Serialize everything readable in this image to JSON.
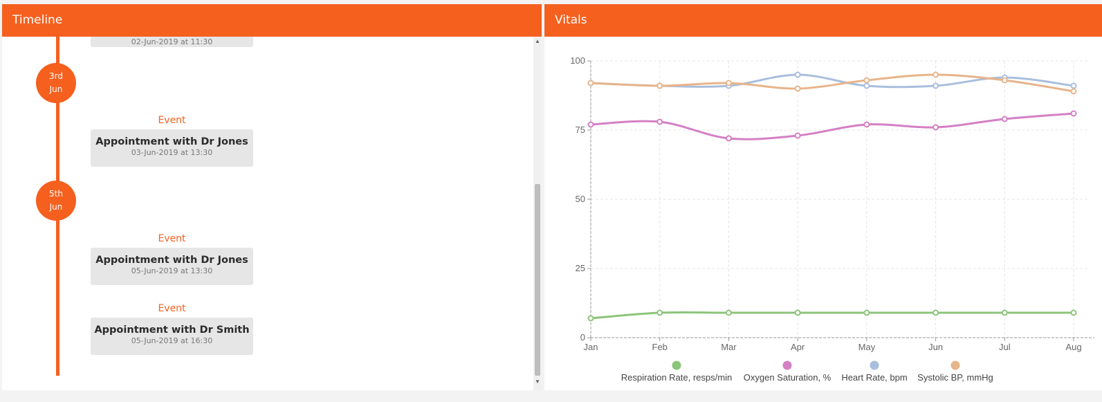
{
  "timeline": {
    "title": "Timeline",
    "partial_card_time": "02-Jun-2019 at 11:30",
    "dates": [
      {
        "day": "3rd",
        "month": "Jun"
      },
      {
        "day": "5th",
        "month": "Jun"
      }
    ],
    "events": [
      {
        "label": "Event",
        "title": "Appointment with Dr Jones",
        "time": "03-Jun-2019 at 13:30"
      },
      {
        "label": "Event",
        "title": "Appointment with Dr Jones",
        "time": "05-Jun-2019 at 13:30"
      },
      {
        "label": "Event",
        "title": "Appointment with Dr Smith",
        "time": "05-Jun-2019 at 16:30"
      }
    ]
  },
  "vitals": {
    "title": "Vitals"
  },
  "chart_data": {
    "type": "line",
    "title": "",
    "xlabel": "",
    "ylabel": "",
    "categories": [
      "Jan",
      "Feb",
      "Mar",
      "Apr",
      "May",
      "Jun",
      "Jul",
      "Aug"
    ],
    "ylim": [
      0,
      100
    ],
    "yticks": [
      0,
      25,
      50,
      75,
      100
    ],
    "grid": true,
    "legend": "bottom",
    "series": [
      {
        "name": "Respiration Rate, resps/min",
        "color": "#8cc47a",
        "values": [
          7,
          9,
          9,
          9,
          9,
          9,
          9,
          9
        ]
      },
      {
        "name": "Oxygen Saturation, %",
        "color": "#d47fc4",
        "values": [
          77,
          78,
          72,
          73,
          77,
          76,
          79,
          81
        ]
      },
      {
        "name": "Heart Rate, bpm",
        "color": "#a8bedd",
        "values": [
          92,
          91,
          91,
          95,
          91,
          91,
          94,
          91
        ]
      },
      {
        "name": "Systolic BP, mmHg",
        "color": "#e8b48a",
        "values": [
          92,
          91,
          92,
          90,
          93,
          95,
          93,
          89
        ]
      }
    ]
  }
}
